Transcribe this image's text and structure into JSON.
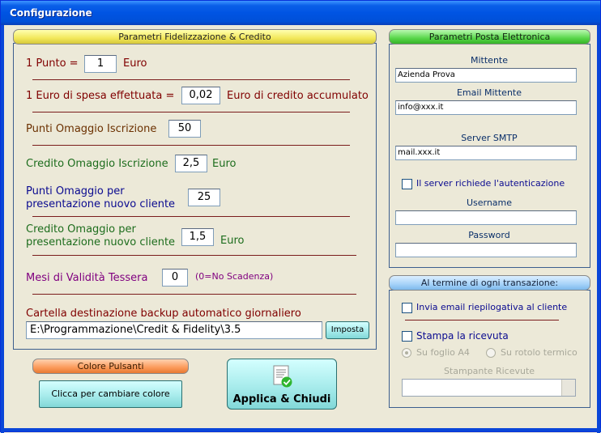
{
  "window": {
    "title": "Configurazione"
  },
  "fidelity": {
    "header": "Parametri Fidelizzazione & Credito",
    "punto_label": "1 Punto =",
    "punto_value": "1",
    "punto_unit": "Euro",
    "euro_spesa_label": "1 Euro di spesa effettuata =",
    "euro_spesa_value": "0,02",
    "euro_spesa_unit": "Euro di credito accumulato",
    "punti_iscr_label": "Punti Omaggio Iscrizione",
    "punti_iscr_value": "50",
    "credito_iscr_label": "Credito Omaggio Iscrizione",
    "credito_iscr_value": "2,5",
    "credito_iscr_unit": "Euro",
    "punti_pres_label_1": "Punti Omaggio per",
    "punti_pres_label_2": "presentazione nuovo cliente",
    "punti_pres_value": "25",
    "credito_pres_label_1": "Credito Omaggio per",
    "credito_pres_label_2": "presentazione nuovo cliente",
    "credito_pres_value": "1,5",
    "credito_pres_unit": "Euro",
    "mesi_label": "Mesi di Validità Tessera",
    "mesi_value": "0",
    "mesi_note": "(0=No Scadenza)",
    "backup_label": "Cartella destinazione backup automatico giornaliero",
    "backup_path": "E:\\Programmazione\\Credit & Fidelity\\3.5",
    "imposta_label": "Imposta"
  },
  "email": {
    "header": "Parametri Posta Elettronica",
    "mittente_label": "Mittente",
    "mittente_value": "Azienda Prova",
    "email_label": "Email Mittente",
    "email_value": "info@xxx.it",
    "smtp_label": "Server SMTP",
    "smtp_value": "mail.xxx.it",
    "auth_label": "Il server richiede l'autenticazione",
    "auth_checked": false,
    "username_label": "Username",
    "username_value": "",
    "password_label": "Password",
    "password_value": ""
  },
  "transaction": {
    "header": "Al termine di ogni transazione:",
    "invia_label": "Invia email riepilogativa al cliente",
    "stampa_label": "Stampa la ricevuta",
    "foglio_label": "Su foglio A4",
    "rotolo_label": "Su rotolo termico",
    "printer_label": "Stampante Ricevute",
    "printer_value": ""
  },
  "colors": {
    "header": "Colore Pulsanti",
    "change_label": "Clicca per cambiare colore"
  },
  "apply": {
    "label": "Applica & Chiudi"
  }
}
